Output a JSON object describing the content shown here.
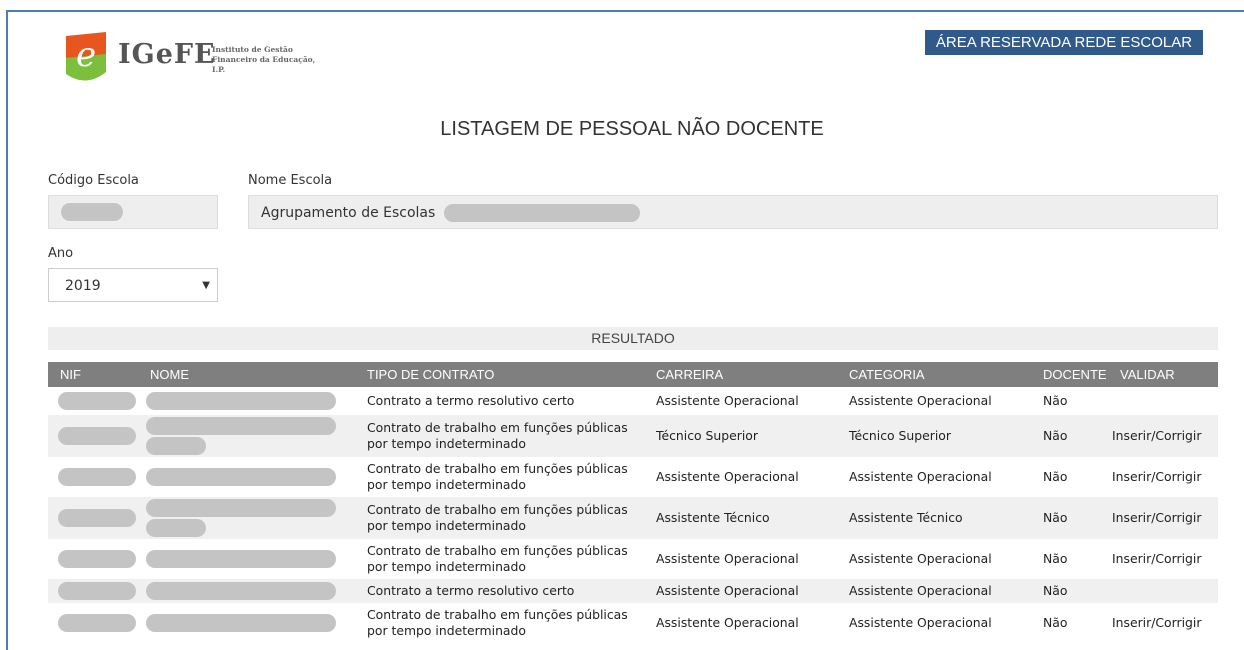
{
  "brand": {
    "logo_text": "IGeFE",
    "subtitle_line1": "Instituto de Gestão",
    "subtitle_line2": "Financeiro da Educação, I.P.",
    "colors": {
      "green": "#7cbf3c",
      "orange": "#e8561f",
      "accent": "#2f5a8a"
    }
  },
  "header": {
    "reserved_area_label": "ÁREA RESERVADA REDE ESCOLAR"
  },
  "main": {
    "title": "LISTAGEM DE PESSOAL NÃO DOCENTE",
    "codigo_escola_label": "Código Escola",
    "nome_escola_label": "Nome Escola",
    "nome_escola_value": "Agrupamento de Escolas",
    "ano_label": "Ano",
    "ano_selected": "2019",
    "result_label": "RESULTADO"
  },
  "table": {
    "columns": [
      "NIF",
      "NOME",
      "TIPO DE CONTRATO",
      "CARREIRA",
      "CATEGORIA",
      "DOCENTE",
      "VALIDAR"
    ],
    "rows": [
      {
        "contrato": "Contrato a termo resolutivo certo",
        "carreira": "Assistente Operacional",
        "categoria": "Assistente Operacional",
        "docente": "Não",
        "inserir": "",
        "sep": "",
        "corrigir": ""
      },
      {
        "contrato": "Contrato de trabalho em funções públicas por tempo indeterminado",
        "carreira": "Técnico Superior",
        "categoria": "Técnico Superior",
        "docente": "Não",
        "inserir": "Inserir",
        "sep": "/",
        "corrigir": "Corrigir"
      },
      {
        "contrato": "Contrato de trabalho em funções públicas por tempo indeterminado",
        "carreira": "Assistente Operacional",
        "categoria": "Assistente Operacional",
        "docente": "Não",
        "inserir": "Inserir",
        "sep": "/",
        "corrigir": "Corrigir"
      },
      {
        "contrato": "Contrato de trabalho em funções públicas por tempo indeterminado",
        "carreira": "Assistente Técnico",
        "categoria": "Assistente Técnico",
        "docente": "Não",
        "inserir": "Inserir",
        "sep": "/",
        "corrigir": "Corrigir"
      },
      {
        "contrato": "Contrato de trabalho em funções públicas por tempo indeterminado",
        "carreira": "Assistente Operacional",
        "categoria": "Assistente Operacional",
        "docente": "Não",
        "inserir": "Inserir",
        "sep": "/",
        "corrigir": "Corrigir"
      },
      {
        "contrato": "Contrato a termo resolutivo certo",
        "carreira": "Assistente Operacional",
        "categoria": "Assistente Operacional",
        "docente": "Não",
        "inserir": "",
        "sep": "",
        "corrigir": ""
      },
      {
        "contrato": "Contrato de trabalho em funções públicas por tempo indeterminado",
        "carreira": "Assistente Operacional",
        "categoria": "Assistente Operacional",
        "docente": "Não",
        "inserir": "Inserir",
        "sep": "/",
        "corrigir": "Corrigir"
      }
    ]
  }
}
